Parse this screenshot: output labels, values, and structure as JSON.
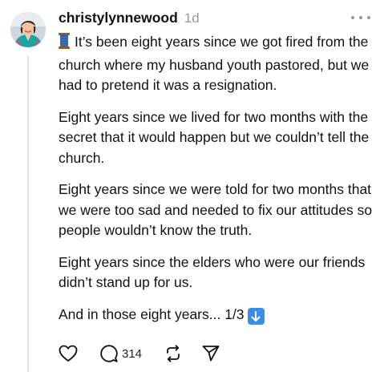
{
  "post": {
    "username": "christylynnewood",
    "timestamp": "1d",
    "paragraphs": [
      "It’s been eight years since we got fired from the church where my husband youth pastored, but we had to pretend it was a resignation.",
      "Eight years since we lived for two months with the secret that it would happen but we couldn’t tell the church.",
      "Eight years since we were told for two months that we were too sad and needed to fix our attitudes so people wouldn’t know the truth.",
      "Eight years since the elders who were our friends didn’t stand up for us.",
      "And in those eight years... 1/3"
    ],
    "icons": {
      "lead": "thread-spool-icon",
      "trail": "down-arrow-icon"
    }
  },
  "actions": {
    "reply_count": "314"
  },
  "colors": {
    "text": "#111111",
    "muted": "#9a9a9a",
    "thread_line": "#e3e3e3",
    "badge": "#3b8ee8"
  }
}
